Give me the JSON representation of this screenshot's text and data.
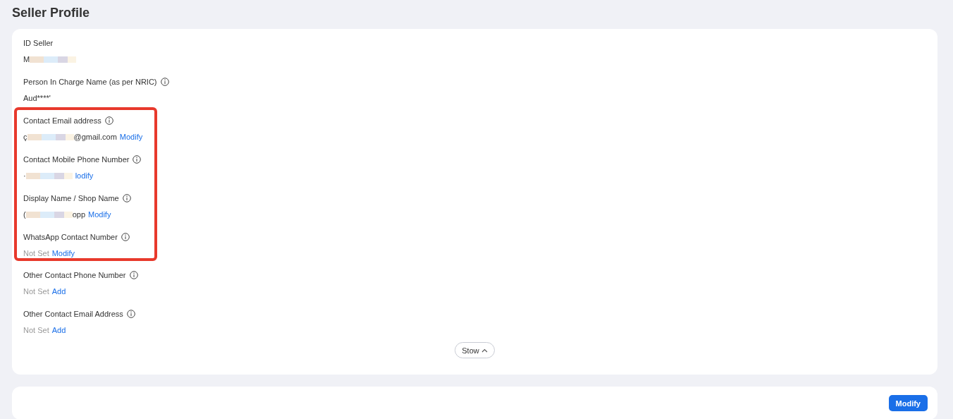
{
  "page_title": "Seller Profile",
  "fields": [
    {
      "label": "ID Seller",
      "info": false,
      "highlighted": false,
      "kind": "value",
      "before": "M",
      "redacted": true
    },
    {
      "label": "Person In Charge Name (as per NRIC)",
      "info": true,
      "highlighted": false,
      "kind": "value",
      "before": "Aud****'",
      "redacted": false
    },
    {
      "label": "Contact Email address",
      "info": true,
      "highlighted": true,
      "kind": "value",
      "before": "ç",
      "redacted": true,
      "after": "@gmail.com",
      "action": "Modify"
    },
    {
      "label": "Contact Mobile Phone Number",
      "info": true,
      "highlighted": true,
      "kind": "value",
      "before": "·",
      "redacted": true,
      "action": "lodify"
    },
    {
      "label": "Display Name / Shop Name",
      "info": true,
      "highlighted": true,
      "kind": "value",
      "before": "(",
      "redacted": true,
      "after": "opp",
      "action": "Modify"
    },
    {
      "label": "WhatsApp Contact Number",
      "info": true,
      "highlighted": true,
      "kind": "not_set",
      "value": "Not Set",
      "action": "Modify"
    },
    {
      "label": "Other Contact Phone Number",
      "info": true,
      "highlighted": false,
      "kind": "not_set",
      "value": "Not Set",
      "action": "Add"
    },
    {
      "label": "Other Contact Email Address",
      "info": true,
      "highlighted": false,
      "kind": "not_set",
      "value": "Not Set",
      "action": "Add"
    }
  ],
  "collapse_button": "Stow",
  "footer_button": "Modify"
}
